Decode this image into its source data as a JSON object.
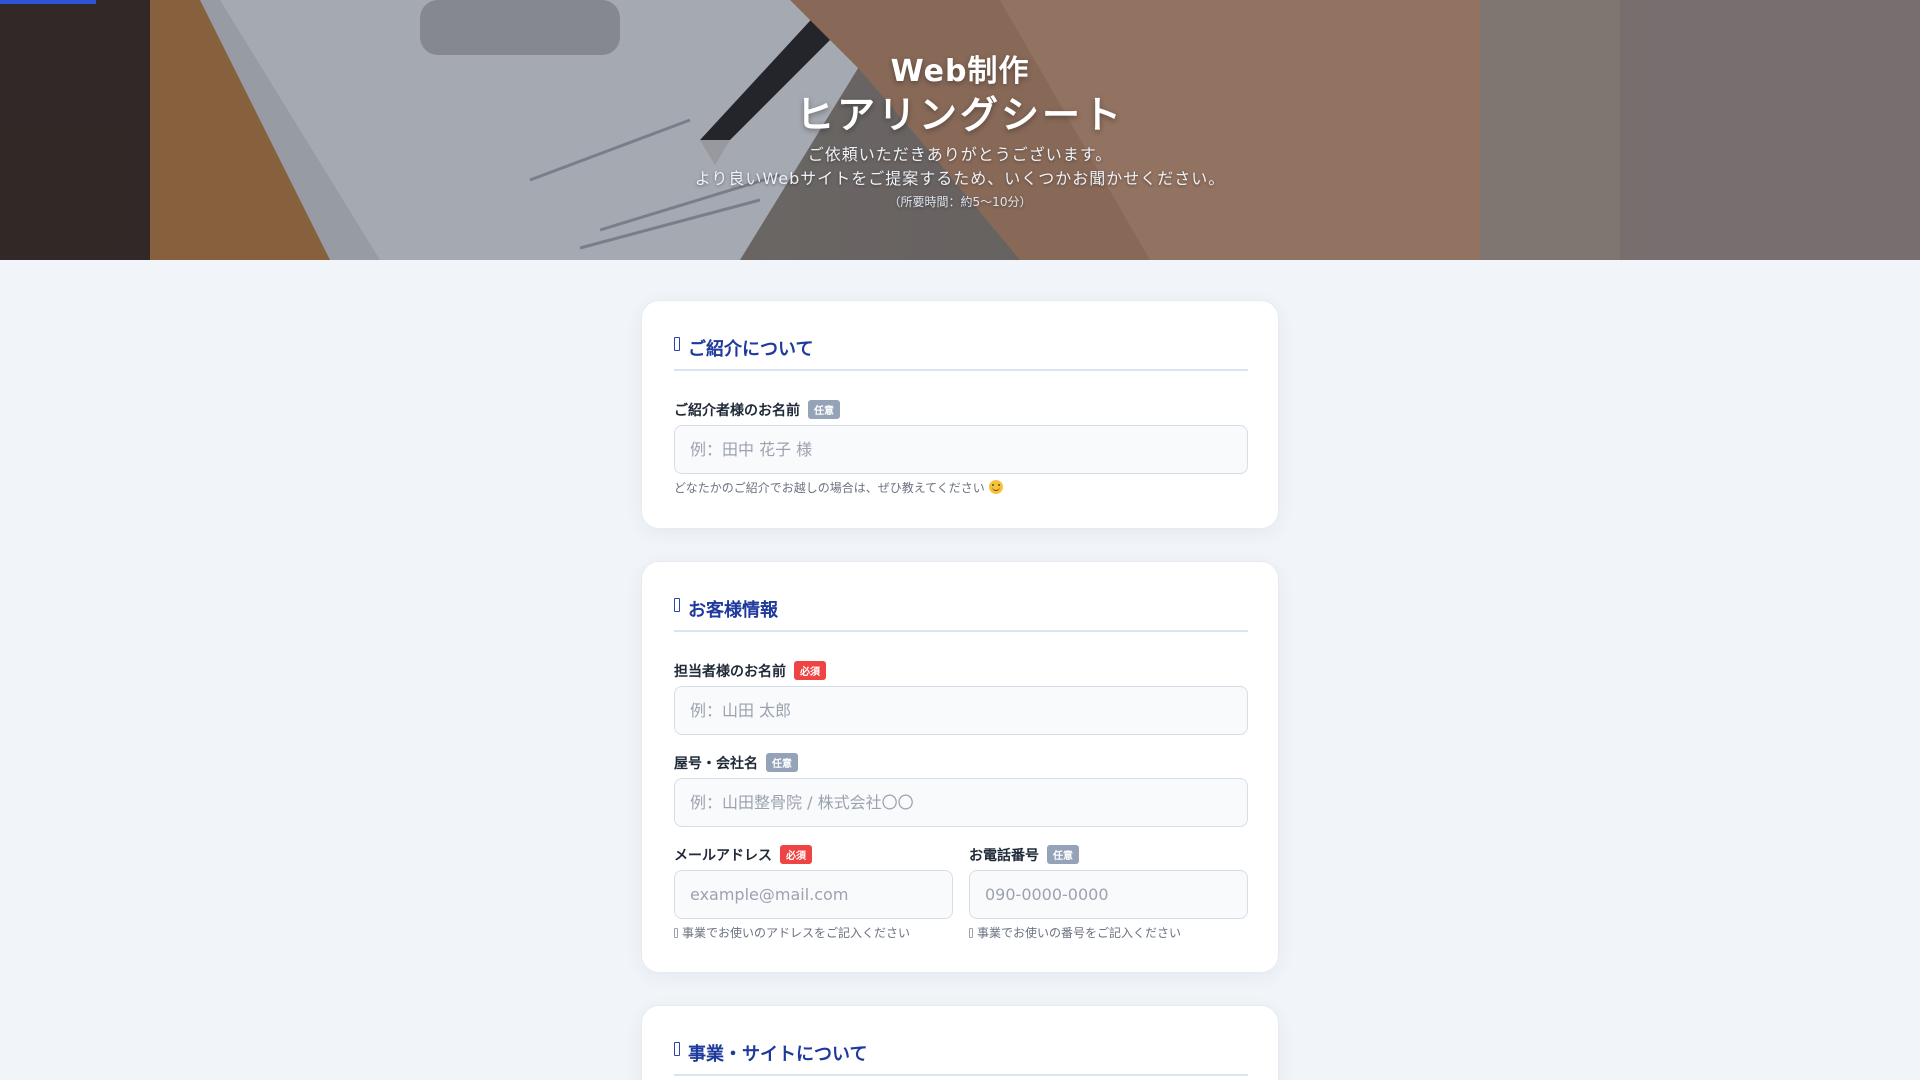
{
  "progress": {
    "percent": 5,
    "color": "#2f55d4"
  },
  "hero": {
    "title_line1": "Web制作",
    "title_line2": "ヒアリングシート",
    "subtitle_line1": "ご依頼いただきありがとうございます。",
    "subtitle_line2": "より良いWebサイトをご提案するため、いくつかお聞かせください。",
    "note": "（所要時間：約5〜10分）",
    "background_image": "photo of a hand signing a contract document with a pen"
  },
  "sections": {
    "referral": {
      "title": "ご紹介について",
      "icon": "document-icon",
      "referrer_name": {
        "label": "ご紹介者様のお名前",
        "badge": "任意",
        "placeholder": "例：田中 花子 様",
        "value": "",
        "help": "どなたかのご紹介でお越しの場合は、ぜひ教えてください",
        "help_icon": "smile-icon"
      }
    },
    "customer": {
      "title": "お客様情報",
      "icon": "document-icon",
      "contact_name": {
        "label": "担当者様のお名前",
        "badge": "必須",
        "placeholder": "例：山田 太郎",
        "value": ""
      },
      "company_name": {
        "label": "屋号・会社名",
        "badge": "任意",
        "placeholder": "例：山田整骨院 / 株式会社〇〇",
        "value": ""
      },
      "email": {
        "label": "メールアドレス",
        "badge": "必須",
        "placeholder": "example@mail.com",
        "value": "",
        "help": "事業でお使いのアドレスをご記入ください"
      },
      "phone": {
        "label": "お電話番号",
        "badge": "任意",
        "placeholder": "090-0000-0000",
        "value": "",
        "help": "事業でお使いの番号をご記入ください"
      }
    },
    "business": {
      "title": "事業・サイトについて",
      "icon": "document-icon"
    }
  },
  "colors": {
    "accent": "#1e3a9c",
    "required_badge": "#ef4444",
    "optional_badge": "#94a3b8",
    "page_background": "#f1f5f9"
  }
}
